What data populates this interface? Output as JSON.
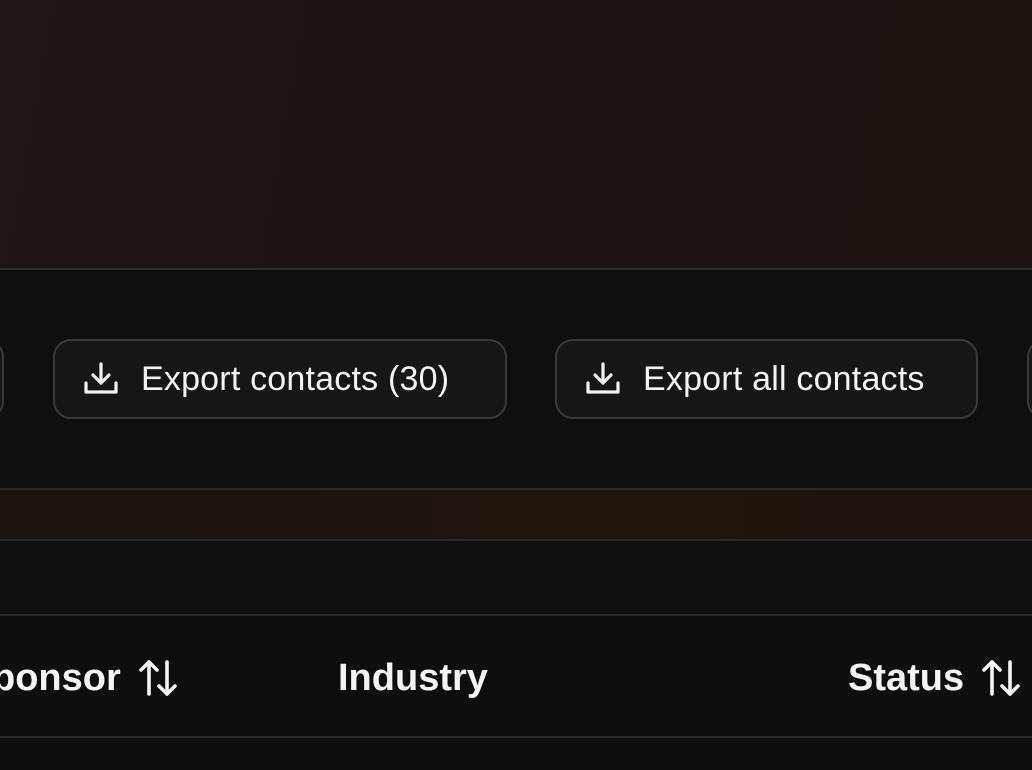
{
  "toolbar": {
    "export_selected_label": "Export contacts (30)",
    "export_all_label": "Export all contacts",
    "export_icon": "download-icon"
  },
  "table": {
    "columns": [
      {
        "label": "ponsor",
        "sortable": true
      },
      {
        "label": "Industry",
        "sortable": false
      },
      {
        "label": "Status",
        "sortable": true
      }
    ],
    "sort_icon": "sort-arrows-icon"
  },
  "colors": {
    "background": "#0e0e0e",
    "button_bg": "#161616",
    "button_border": "#3a3a3a",
    "hero_tint": "#1d140f",
    "text": "#f2f2f2"
  }
}
